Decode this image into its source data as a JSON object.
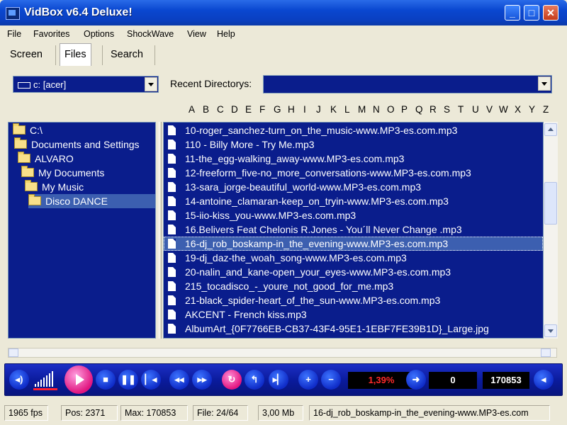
{
  "window": {
    "title": "VidBox v6.4 Deluxe!",
    "minimize": "_",
    "maximize": "□",
    "close": "✕"
  },
  "menu": [
    "File",
    "Favorites",
    "Options",
    "ShockWave",
    "View",
    "Help"
  ],
  "tabs": [
    {
      "label": "Screen",
      "active": false
    },
    {
      "label": "Files",
      "active": true
    },
    {
      "label": "Search",
      "active": false
    }
  ],
  "drive": {
    "value": "c: [acer]"
  },
  "recent": {
    "label": "Recent Directorys:",
    "value": ""
  },
  "alphabet": [
    "A",
    "B",
    "C",
    "D",
    "E",
    "F",
    "G",
    "H",
    "I",
    "J",
    "K",
    "L",
    "M",
    "N",
    "O",
    "P",
    "Q",
    "R",
    "S",
    "T",
    "U",
    "V",
    "W",
    "X",
    "Y",
    "Z"
  ],
  "tree": [
    {
      "label": "C:\\",
      "selected": false
    },
    {
      "label": "Documents and Settings",
      "selected": false
    },
    {
      "label": "ALVARO",
      "selected": false
    },
    {
      "label": "My Documents",
      "selected": false
    },
    {
      "label": "My Music",
      "selected": false
    },
    {
      "label": "Disco DANCE",
      "selected": true
    }
  ],
  "files": [
    {
      "name": "10-roger_sanchez-turn_on_the_music-www.MP3-es.com.mp3",
      "selected": false
    },
    {
      "name": "110 - Billy More - Try Me.mp3",
      "selected": false
    },
    {
      "name": "11-the_egg-walking_away-www.MP3-es.com.mp3",
      "selected": false
    },
    {
      "name": "12-freeform_five-no_more_conversations-www.MP3-es.com.mp3",
      "selected": false
    },
    {
      "name": "13-sara_jorge-beautiful_world-www.MP3-es.com.mp3",
      "selected": false
    },
    {
      "name": "14-antoine_clamaran-keep_on_tryin-www.MP3-es.com.mp3",
      "selected": false
    },
    {
      "name": "15-iio-kiss_you-www.MP3-es.com.mp3",
      "selected": false
    },
    {
      "name": "16.Belivers Feat Chelonis R.Jones - You´ll Never Change .mp3",
      "selected": false
    },
    {
      "name": "16-dj_rob_boskamp-in_the_evening-www.MP3-es.com.mp3",
      "selected": true
    },
    {
      "name": "19-dj_daz-the_woah_song-www.MP3-es.com.mp3",
      "selected": false
    },
    {
      "name": "20-nalin_and_kane-open_your_eyes-www.MP3-es.com.mp3",
      "selected": false
    },
    {
      "name": "215_tocadisco_-_youre_not_good_for_me.mp3",
      "selected": false
    },
    {
      "name": "21-black_spider-heart_of_the_sun-www.MP3-es.com.mp3",
      "selected": false
    },
    {
      "name": "AKCENT - French kiss.mp3",
      "selected": false
    },
    {
      "name": "AlbumArt_{0F7766EB-CB37-43F4-95E1-1EBF7FE39B1D}_Large.jpg",
      "selected": false
    }
  ],
  "controls": {
    "icons": [
      "volume-icon",
      "play-icon",
      "stop-icon",
      "pause-icon",
      "prev-icon",
      "rewind-icon",
      "forward-icon",
      "loop-icon",
      "step-back-icon",
      "step-forward-icon",
      "zoom-in-icon",
      "zoom-out-icon",
      "goto-icon",
      "back-icon"
    ],
    "percent": "1,39%",
    "position": "0",
    "max": "170853"
  },
  "status": {
    "fps": "1965 fps",
    "pos": "Pos: 2371",
    "max": "Max: 170853",
    "file": "File: 24/64",
    "size": "3,00 Mb",
    "current": "16-dj_rob_boskamp-in_the_evening-www.MP3-es.com"
  },
  "colors": {
    "list_bg": "#0a1d8c",
    "selection": "#3c5fb0",
    "titlebar": "#0a47d0",
    "accent_pink": "#e2157f"
  }
}
